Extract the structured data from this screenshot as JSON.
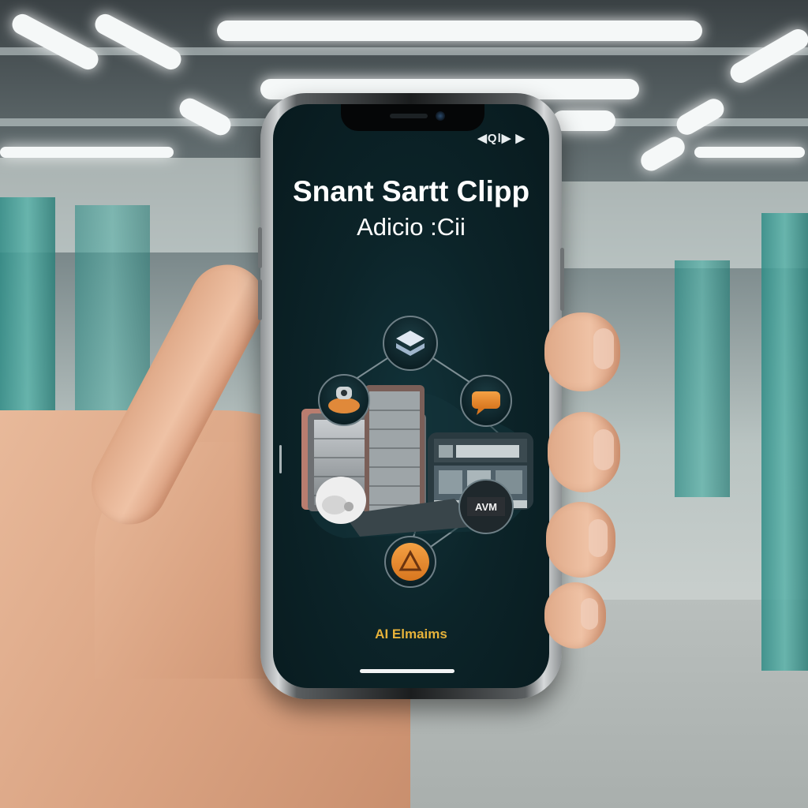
{
  "status_bar": {
    "icons_text": "◀Ql▶ ▶"
  },
  "app": {
    "title": "Snant Sartt Clipp",
    "subtitle": "Adicio :Cii",
    "footer_brand": "AI Elmaims",
    "mock_sign": "AVM"
  },
  "diagram_nodes": [
    {
      "id": "top",
      "icon": "layers-icon",
      "color": "#c8d6e6"
    },
    {
      "id": "left",
      "icon": "robot-device-icon",
      "color": "#e0893a"
    },
    {
      "id": "right",
      "icon": "chat-bubble-icon",
      "color": "#e08a3b"
    },
    {
      "id": "bottom-right",
      "icon": "brand-logo-icon",
      "color": "#2b2f33"
    },
    {
      "id": "bottom",
      "icon": "triangle-logo-icon",
      "color": "#e88a30"
    },
    {
      "id": "camera",
      "icon": "security-camera-icon",
      "color": "#f3f3f3"
    }
  ],
  "colors": {
    "screen_bg": "#0c2429",
    "accent_orange": "#e8892f",
    "footer_gold": "#e6b23a",
    "node_ring": "#6e7f86"
  }
}
